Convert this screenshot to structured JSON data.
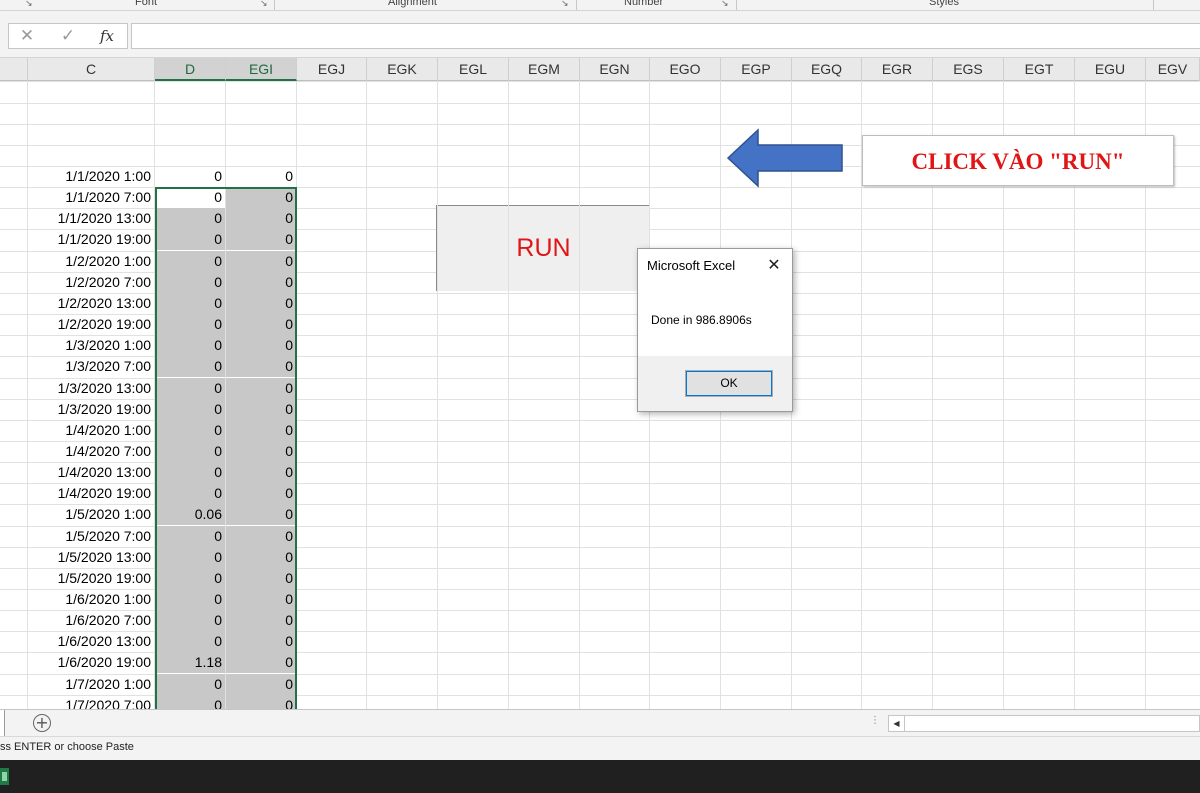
{
  "ribbon": {
    "groups": [
      "Font",
      "Alignment",
      "Number",
      "Styles"
    ]
  },
  "formula_bar": {
    "cancel_icon": "close-icon",
    "enter_icon": "checkmark-icon",
    "function_label": "fx",
    "value": ""
  },
  "columns": [
    "C",
    "D",
    "EGI",
    "EGJ",
    "EGK",
    "EGL",
    "EGM",
    "EGN",
    "EGO",
    "EGP",
    "EGQ",
    "EGR",
    "EGS",
    "EGT",
    "EGU",
    "EGV"
  ],
  "selected_columns": [
    "D",
    "EGI"
  ],
  "rows": [
    {
      "date": "1/1/2020 1:00",
      "d": "0",
      "egi": "0"
    },
    {
      "date": "1/1/2020 7:00",
      "d": "0",
      "egi": "0"
    },
    {
      "date": "1/1/2020 13:00",
      "d": "0",
      "egi": "0"
    },
    {
      "date": "1/1/2020 19:00",
      "d": "0",
      "egi": "0"
    },
    {
      "date": "1/2/2020 1:00",
      "d": "0",
      "egi": "0"
    },
    {
      "date": "1/2/2020 7:00",
      "d": "0",
      "egi": "0"
    },
    {
      "date": "1/2/2020 13:00",
      "d": "0",
      "egi": "0"
    },
    {
      "date": "1/2/2020 19:00",
      "d": "0",
      "egi": "0"
    },
    {
      "date": "1/3/2020 1:00",
      "d": "0",
      "egi": "0"
    },
    {
      "date": "1/3/2020 7:00",
      "d": "0",
      "egi": "0"
    },
    {
      "date": "1/3/2020 13:00",
      "d": "0",
      "egi": "0"
    },
    {
      "date": "1/3/2020 19:00",
      "d": "0",
      "egi": "0"
    },
    {
      "date": "1/4/2020 1:00",
      "d": "0",
      "egi": "0"
    },
    {
      "date": "1/4/2020 7:00",
      "d": "0",
      "egi": "0"
    },
    {
      "date": "1/4/2020 13:00",
      "d": "0",
      "egi": "0"
    },
    {
      "date": "1/4/2020 19:00",
      "d": "0",
      "egi": "0"
    },
    {
      "date": "1/5/2020 1:00",
      "d": "0.06",
      "egi": "0"
    },
    {
      "date": "1/5/2020 7:00",
      "d": "0",
      "egi": "0"
    },
    {
      "date": "1/5/2020 13:00",
      "d": "0",
      "egi": "0"
    },
    {
      "date": "1/5/2020 19:00",
      "d": "0",
      "egi": "0"
    },
    {
      "date": "1/6/2020 1:00",
      "d": "0",
      "egi": "0"
    },
    {
      "date": "1/6/2020 7:00",
      "d": "0",
      "egi": "0"
    },
    {
      "date": "1/6/2020 13:00",
      "d": "0",
      "egi": "0"
    },
    {
      "date": "1/6/2020 19:00",
      "d": "1.18",
      "egi": "0"
    },
    {
      "date": "1/7/2020 1:00",
      "d": "0",
      "egi": "0"
    },
    {
      "date": "1/7/2020 7:00",
      "d": "0",
      "egi": "0"
    }
  ],
  "run_button": {
    "label": "RUN",
    "color": "#e01515"
  },
  "callout": {
    "label": "CLICK VÀO \"RUN\"",
    "color": "#e01515",
    "arrow_color": "#4472c4",
    "arrow_icon": "arrow-left-icon"
  },
  "dialog": {
    "title": "Microsoft Excel",
    "message": "Done in 986.8906s",
    "ok_label": "OK",
    "close_glyph": "✕"
  },
  "tabbar": {
    "add_sheet_glyph": "+",
    "dots": "⋮"
  },
  "status": {
    "text": "ss ENTER or choose Paste"
  },
  "taskbar": {
    "app_icon": "excel-icon"
  },
  "colors": {
    "accent": "#217346",
    "selection_fill": "#c8c8c8"
  }
}
